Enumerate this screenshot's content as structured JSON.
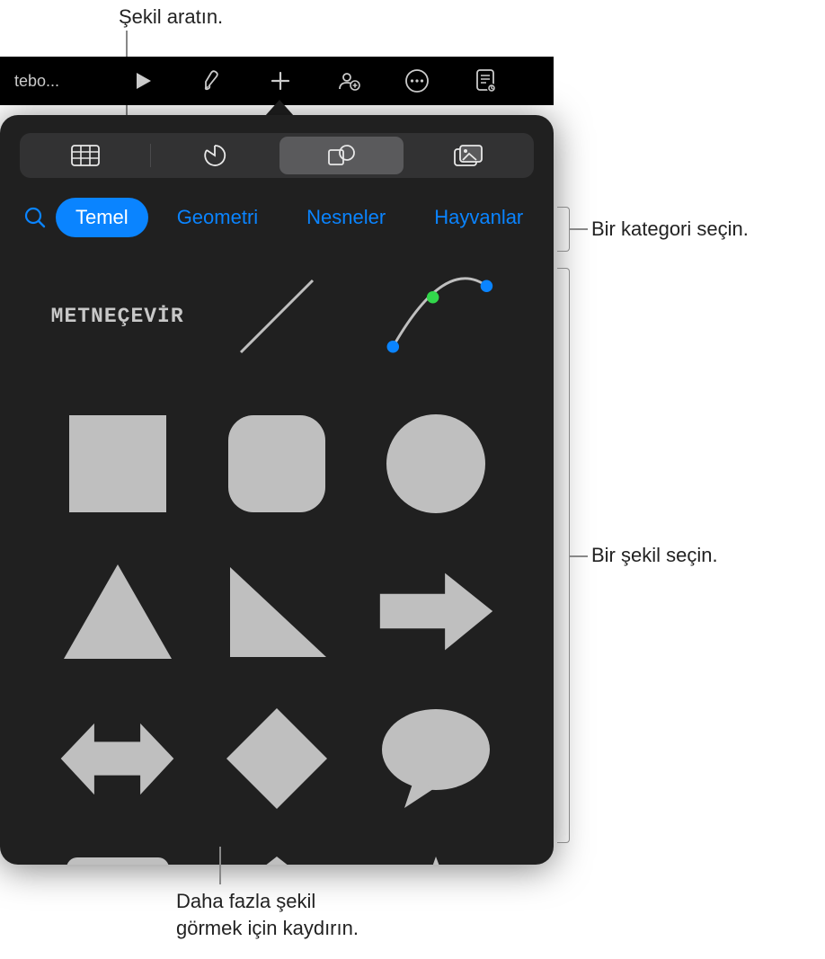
{
  "callouts": {
    "search": "Şekil aratın.",
    "category": "Bir kategori seçin.",
    "pick_shape": "Bir şekil seçin.",
    "scroll_more_l1": "Daha fazla şekil",
    "scroll_more_l2": "görmek için kaydırın."
  },
  "toolbar": {
    "title": "tebo..."
  },
  "categories": {
    "c0": "Temel",
    "c1": "Geometri",
    "c2": "Nesneler",
    "c3": "Hayvanlar"
  },
  "shapes": {
    "text_label": "METNEÇEVİR",
    "names": {
      "s0": "text-shape",
      "s1": "line-shape",
      "s2": "curve-pen-shape",
      "s3": "square-shape",
      "s4": "rounded-square-shape",
      "s5": "circle-shape",
      "s6": "triangle-shape",
      "s7": "right-triangle-shape",
      "s8": "arrow-right-shape",
      "s9": "double-arrow-shape",
      "s10": "diamond-shape",
      "s11": "speech-bubble-shape",
      "s12": "callout-rect-shape",
      "s13": "pentagon-shape",
      "s14": "star-shape"
    }
  },
  "colors": {
    "accent": "#0a84ff",
    "shape_fill": "#bfbfbf",
    "popover_bg": "#202020"
  }
}
